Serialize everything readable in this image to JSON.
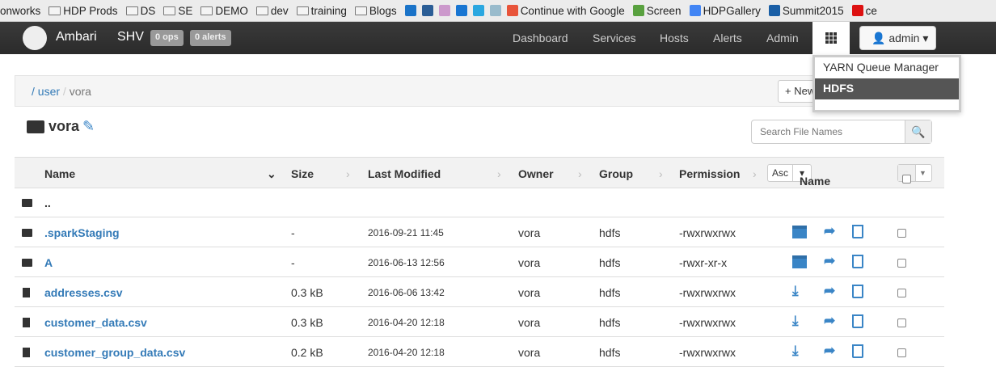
{
  "bookmarks": [
    "onworks",
    "HDP Prods",
    "DS",
    "SE",
    "DEMO",
    "dev",
    "training",
    "Blogs",
    "Continue with Google",
    "Screen",
    "HDPGallery",
    "Summit2015",
    "ce"
  ],
  "navbar": {
    "brand": "Ambari",
    "cluster": "SHV",
    "ops_badge": "0 ops",
    "alerts_badge": "0 alerts",
    "links": [
      "Dashboard",
      "Services",
      "Hosts",
      "Alerts",
      "Admin"
    ],
    "user": "admin"
  },
  "views_menu": {
    "items": [
      "YARN Queue Manager",
      "HDFS"
    ],
    "active": "HDFS"
  },
  "breadcrumb": {
    "items": [
      "/",
      "user",
      "/",
      "vora"
    ]
  },
  "new_button": "+ New",
  "folder_title": "vora",
  "search": {
    "placeholder": "Search File Names"
  },
  "table": {
    "headers": [
      "Name",
      "Size",
      "Last Modified",
      "Owner",
      "Group",
      "Permission"
    ],
    "sort": {
      "order": "Asc",
      "field": "Name"
    },
    "rows": [
      {
        "name": "..",
        "type": "folder",
        "size": "",
        "modified": "",
        "owner": "",
        "group": "",
        "permission": ""
      },
      {
        "name": ".sparkStaging",
        "type": "folder",
        "size": "-",
        "modified": "2016-09-21 11:45",
        "owner": "vora",
        "group": "hdfs",
        "permission": "-rwxrwxrwx"
      },
      {
        "name": "A",
        "type": "folder",
        "size": "-",
        "modified": "2016-06-13 12:56",
        "owner": "vora",
        "group": "hdfs",
        "permission": "-rwxr-xr-x"
      },
      {
        "name": "addresses.csv",
        "type": "file",
        "size": "0.3 kB",
        "modified": "2016-06-06 13:42",
        "owner": "vora",
        "group": "hdfs",
        "permission": "-rwxrwxrwx"
      },
      {
        "name": "customer_data.csv",
        "type": "file",
        "size": "0.3 kB",
        "modified": "2016-04-20 12:18",
        "owner": "vora",
        "group": "hdfs",
        "permission": "-rwxrwxrwx"
      },
      {
        "name": "customer_group_data.csv",
        "type": "file",
        "size": "0.2 kB",
        "modified": "2016-04-20 12:18",
        "owner": "vora",
        "group": "hdfs",
        "permission": "-rwxrwxrwx"
      }
    ]
  },
  "colors": {
    "navbar": "#2f2f2f",
    "link": "#337ab7",
    "action_icon": "#3a85c6",
    "menu_active": "#555555"
  }
}
